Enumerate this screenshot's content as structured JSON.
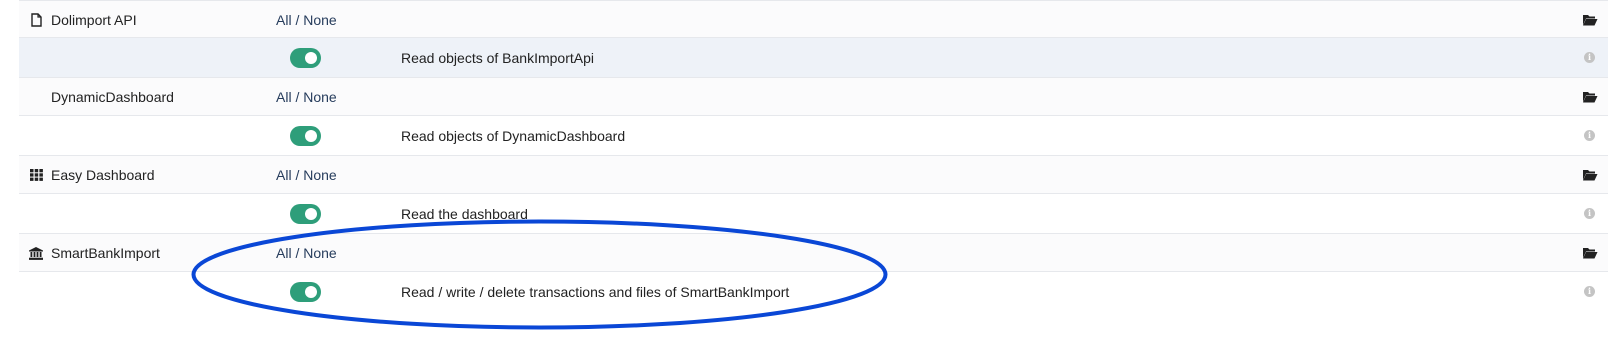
{
  "modules": [
    {
      "name": "Dolimport API",
      "icon": "file-icon",
      "all_label": "All",
      "separator": "/",
      "none_label": "None",
      "permissions": [
        {
          "label": "Read objects of BankImportApi",
          "enabled": true
        }
      ]
    },
    {
      "name": "DynamicDashboard",
      "icon": "",
      "all_label": "All",
      "separator": "/",
      "none_label": "None",
      "permissions": [
        {
          "label": "Read objects of DynamicDashboard",
          "enabled": true
        }
      ]
    },
    {
      "name": "Easy Dashboard",
      "icon": "grid-icon",
      "all_label": "All",
      "separator": "/",
      "none_label": "None",
      "permissions": [
        {
          "label": "Read the dashboard",
          "enabled": true
        }
      ]
    },
    {
      "name": "SmartBankImport",
      "icon": "bank-icon",
      "all_label": "All",
      "separator": "/",
      "none_label": "None",
      "permissions": [
        {
          "label": "Read / write / delete transactions and files of SmartBankImport",
          "enabled": true
        }
      ]
    }
  ],
  "colors": {
    "toggle_on": "#2e9e7a",
    "annotation": "#0a47d6",
    "link": "#263c5c"
  },
  "icons": {
    "module_folder": "folder-open-icon",
    "permission_info": "info-icon"
  }
}
